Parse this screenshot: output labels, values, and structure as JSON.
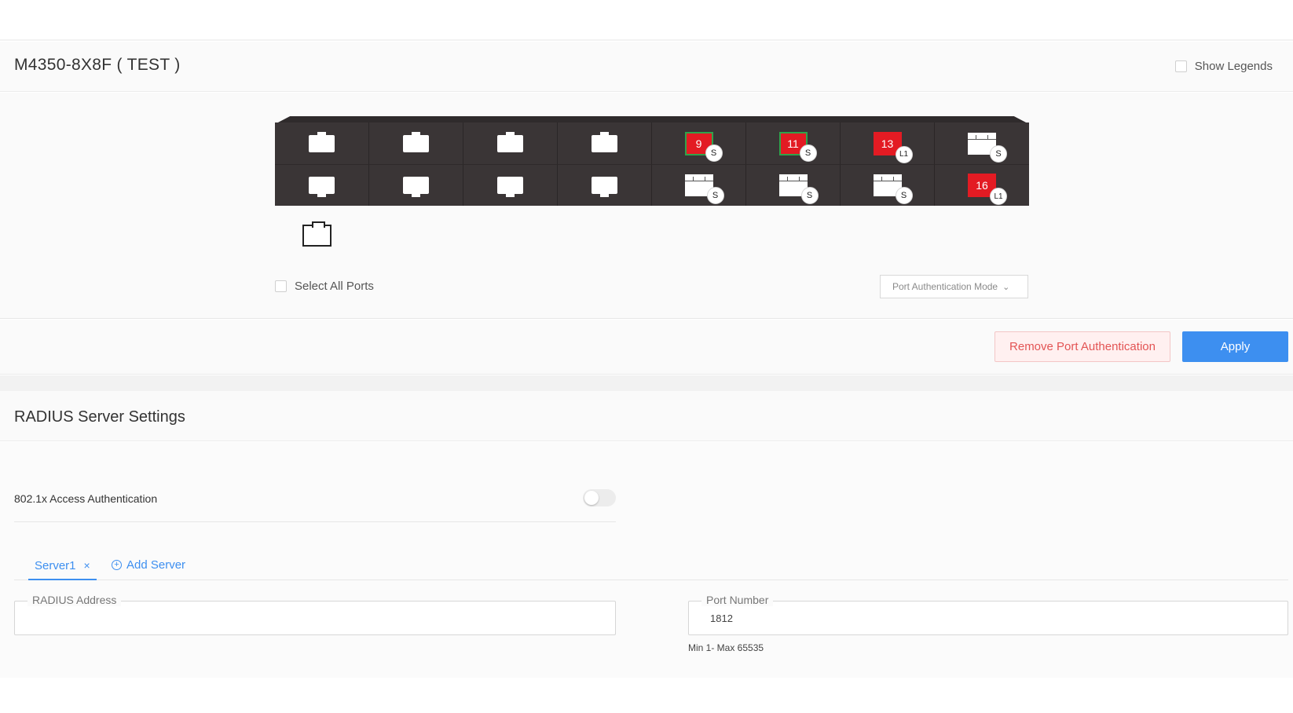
{
  "device": {
    "title": "M4350-8X8F ( TEST )",
    "show_legends_label": "Show Legends"
  },
  "ports": {
    "top_row": [
      {
        "kind": "rj45",
        "label": "",
        "badge": ""
      },
      {
        "kind": "rj45",
        "label": "",
        "badge": ""
      },
      {
        "kind": "rj45",
        "label": "",
        "badge": ""
      },
      {
        "kind": "rj45",
        "label": "",
        "badge": ""
      },
      {
        "kind": "red-green",
        "label": "9",
        "badge": "S"
      },
      {
        "kind": "red-green",
        "label": "11",
        "badge": "S"
      },
      {
        "kind": "red",
        "label": "13",
        "badge": "L1"
      },
      {
        "kind": "sfp",
        "label": "",
        "badge": "S"
      }
    ],
    "bottom_row": [
      {
        "kind": "rj45",
        "label": "",
        "badge": ""
      },
      {
        "kind": "rj45",
        "label": "",
        "badge": ""
      },
      {
        "kind": "rj45",
        "label": "",
        "badge": ""
      },
      {
        "kind": "rj45",
        "label": "",
        "badge": ""
      },
      {
        "kind": "sfp",
        "label": "",
        "badge": "S"
      },
      {
        "kind": "sfp",
        "label": "",
        "badge": "S"
      },
      {
        "kind": "sfp",
        "label": "",
        "badge": "S"
      },
      {
        "kind": "red",
        "label": "16",
        "badge": "L1"
      }
    ],
    "colors": {
      "selected": "#e31b23",
      "active_border": "#2fa34b",
      "chassis": "#3a3536"
    }
  },
  "controls": {
    "select_all_label": "Select All Ports",
    "auth_mode_placeholder": "Port Authentication Mode",
    "remove_label": "Remove Port Authentication",
    "apply_label": "Apply"
  },
  "radius": {
    "title": "RADIUS Server Settings",
    "access_auth_label": "802.1x Access Authentication",
    "access_auth_enabled": false,
    "tabs": [
      {
        "label": "Server1",
        "close_icon": "×"
      }
    ],
    "add_server_label": "Add Server",
    "address_label": "RADIUS Address",
    "address_value": "",
    "port_label": "Port Number",
    "port_value": "1812",
    "port_hint": "Min 1- Max 65535"
  },
  "colors": {
    "accent": "#3d8ff0",
    "danger": "#e35454"
  }
}
